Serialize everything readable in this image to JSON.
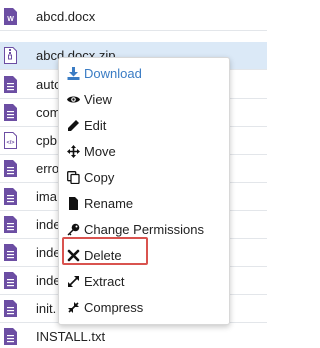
{
  "files": [
    {
      "name": "abcd.docx",
      "icon": "word-doc-icon"
    },
    {
      "name": "abcd.docx.zip",
      "icon": "archive-icon"
    },
    {
      "name": "auto",
      "icon": "text-file-icon"
    },
    {
      "name": "com",
      "icon": "text-file-icon"
    },
    {
      "name": "cpb",
      "icon": "code-file-icon"
    },
    {
      "name": "erro",
      "icon": "text-file-icon"
    },
    {
      "name": "ima",
      "icon": "text-file-icon"
    },
    {
      "name": "inde",
      "icon": "text-file-icon"
    },
    {
      "name": "inde",
      "icon": "text-file-icon"
    },
    {
      "name": "inde",
      "icon": "text-file-icon"
    },
    {
      "name": "init.",
      "icon": "text-file-icon"
    },
    {
      "name": "INSTALL.txt",
      "icon": "text-file-icon"
    }
  ],
  "menu": {
    "items": [
      {
        "label": "Download",
        "icon": "download-icon"
      },
      {
        "label": "View",
        "icon": "eye-icon"
      },
      {
        "label": "Edit",
        "icon": "pencil-icon"
      },
      {
        "label": "Move",
        "icon": "move-arrows-icon"
      },
      {
        "label": "Copy",
        "icon": "copy-icon"
      },
      {
        "label": "Rename",
        "icon": "file-icon"
      },
      {
        "label": "Change Permissions",
        "icon": "key-icon"
      },
      {
        "label": "Delete",
        "icon": "close-icon"
      },
      {
        "label": "Extract",
        "icon": "expand-icon"
      },
      {
        "label": "Compress",
        "icon": "compress-icon"
      }
    ],
    "highlighted": "Extract"
  },
  "colors": {
    "accent": "#3a7cc4",
    "selected_row": "#dbe9f7",
    "file_icon": "#6c4ea3",
    "highlight_border": "#d9534f"
  }
}
